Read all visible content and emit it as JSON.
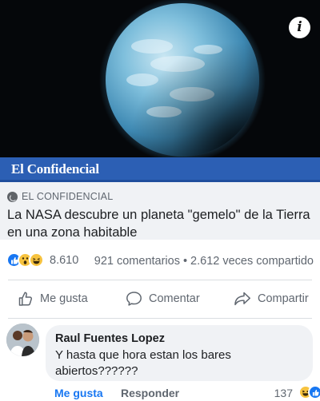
{
  "post": {
    "media": {
      "alt": "planet image",
      "info_icon": "info-icon"
    },
    "brand_bar": {
      "text": "El Confidencial"
    },
    "preview": {
      "source": "EL CONFIDENCIAL",
      "headline": "La NASA descubre un planeta \"gemelo\" de la Tierra en una zona habitable"
    },
    "stats": {
      "reaction_icons": [
        "like-icon",
        "wow-icon",
        "haha-icon"
      ],
      "reaction_count": "8.610",
      "comments": "921 comentarios",
      "separator": "•",
      "shares": "2.612 veces compartido"
    },
    "actions": {
      "like": "Me gusta",
      "comment": "Comentar",
      "share": "Compartir"
    }
  },
  "comment": {
    "author": "Raul Fuentes Lopez",
    "text": "Y hasta que hora estan los bares abiertos??????",
    "like_label": "Me gusta",
    "reply_label": "Responder",
    "reaction_count": "137",
    "reaction_icons": [
      "haha-icon",
      "like-icon"
    ]
  },
  "colors": {
    "brand_bar": "#2c5fb4",
    "facebook_blue": "#1877f2",
    "preview_bg": "#f0f2f5",
    "secondary_text": "#606770"
  }
}
